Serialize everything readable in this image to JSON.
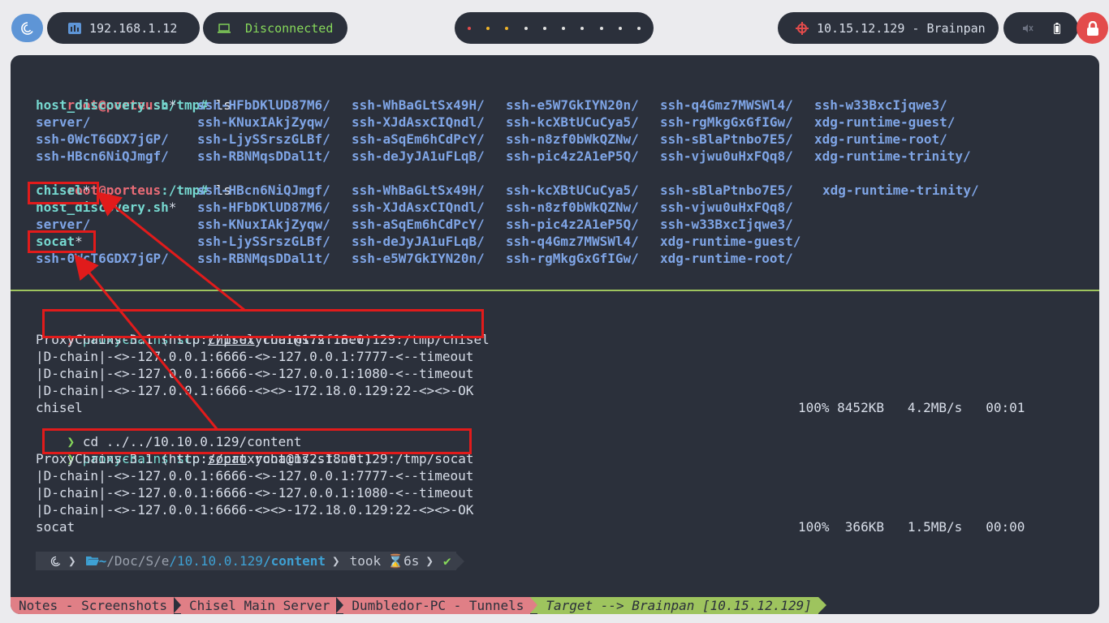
{
  "topbar": {
    "ip_label": "192.168.1.12",
    "vpn_status": "Disconnected",
    "target_label": "10.15.12.129 - Brainpan",
    "accent_ip_icon": "#5e95d6",
    "accent_disconnected": "#86d85a",
    "accent_target": "#e34b4b"
  },
  "pane1": {
    "prompt1_user": "root@porteus",
    "prompt1_path": ":/tmp#",
    "prompt1_cmd": " ls",
    "ls1": [
      [
        "host_discovery.sh",
        "ssh-HFbDKlUD87M6/",
        "ssh-WhBaGLtSx49H/",
        "ssh-e5W7GkIYN20n/",
        "ssh-q4Gmz7MWSWl4/",
        "ssh-w33BxcIjqwe3/"
      ],
      [
        "server/",
        "ssh-KNuxIAkjZyqw/",
        "ssh-XJdAsxCIQndl/",
        "ssh-kcXBtUCuCya5/",
        "ssh-rgMkgGxGfIGw/",
        "xdg-runtime-guest/"
      ],
      [
        "ssh-0WcT6GDX7jGP/",
        "ssh-LjySSrszGLBf/",
        "ssh-aSqEm6hCdPcY/",
        "ssh-n8zf0bWkQZNw/",
        "ssh-sBlaPtnbo7E5/",
        "xdg-runtime-root/"
      ],
      [
        "ssh-HBcn6NiQJmgf/",
        "ssh-RBNMqsDDal1t/",
        "ssh-deJyJA1uFLqB/",
        "ssh-pic4z2A1eP5Q/",
        "ssh-vjwu0uHxFQq8/",
        "xdg-runtime-trinity/"
      ]
    ],
    "prompt2_user": "root@porteus",
    "prompt2_path": ":/tmp#",
    "prompt2_cmd": " ls",
    "ls2": [
      [
        "chisel",
        "ssh-HBcn6NiQJmgf/",
        "ssh-WhBaGLtSx49H/",
        "ssh-kcXBtUCuCya5/",
        "ssh-sBlaPtnbo7E5/",
        "xdg-runtime-trinity/"
      ],
      [
        "host_discovery.sh",
        "ssh-HFbDKlUD87M6/",
        "ssh-XJdAsxCIQndl/",
        "ssh-n8zf0bWkQZNw/",
        "ssh-vjwu0uHxFQq8/",
        ""
      ],
      [
        "server/",
        "ssh-KNuxIAkjZyqw/",
        "ssh-aSqEm6hCdPcY/",
        "ssh-pic4z2A1eP5Q/",
        "ssh-w33BxcIjqwe3/",
        ""
      ],
      [
        "socat",
        "ssh-LjySSrszGLBf/",
        "ssh-deJyJA1uFLqB/",
        "ssh-q4Gmz7MWSWl4/",
        "xdg-runtime-guest/",
        ""
      ],
      [
        "ssh-0WcT6GDX7jGP/",
        "ssh-RBNMqsDDal1t/",
        "ssh-e5W7GkIYN20n/",
        "ssh-rgMkgGxGfIGw/",
        "xdg-runtime-root/",
        ""
      ]
    ],
    "exec_star": "*"
  },
  "pane2": {
    "cmd1_a": "proxychains scp ",
    "cmd1_file": "chisel",
    "cmd1_b": " root@172.18.0.129:/tmp/chisel",
    "pc_banner": "ProxyChains-3.1 (http://proxychains.sf.net)",
    "chain1": "|D-chain|-<>-127.0.0.1:6666-<>-127.0.0.1:7777-<--timeout",
    "chain2": "|D-chain|-<>-127.0.0.1:6666-<>-127.0.0.1:1080-<--timeout",
    "chain3": "|D-chain|-<>-127.0.0.1:6666-<><>-172.18.0.129:22-<><>-OK",
    "xfer1_name": "chisel",
    "xfer1_stats": "100% 8452KB   4.2MB/s   00:01",
    "cd_cmd": "cd ../../10.10.0.129/content",
    "cmd2_a": "proxychains scp ",
    "cmd2_file": "socat",
    "cmd2_b": " root@172.18.0.129:/tmp/socat",
    "xfer2_name": "socat",
    "xfer2_stats": "100%  366KB   1.5MB/s   00:00",
    "prompt_arrow": "❯"
  },
  "powerline": {
    "path_home": "~",
    "path_doc": "/Doc",
    "path_s": "/S",
    "path_e": "/e",
    "path_ip": "/10.10.0.129",
    "path_content": "/content",
    "took": "took",
    "duration": "6s",
    "check": "✔"
  },
  "statusbar": {
    "tab1": "Notes - Screenshots",
    "tab2": "Chisel Main Server",
    "tab3": "Dumbledor-PC - Tunnels",
    "tab4": "Target --> Brainpan [10.15.12.129]"
  }
}
